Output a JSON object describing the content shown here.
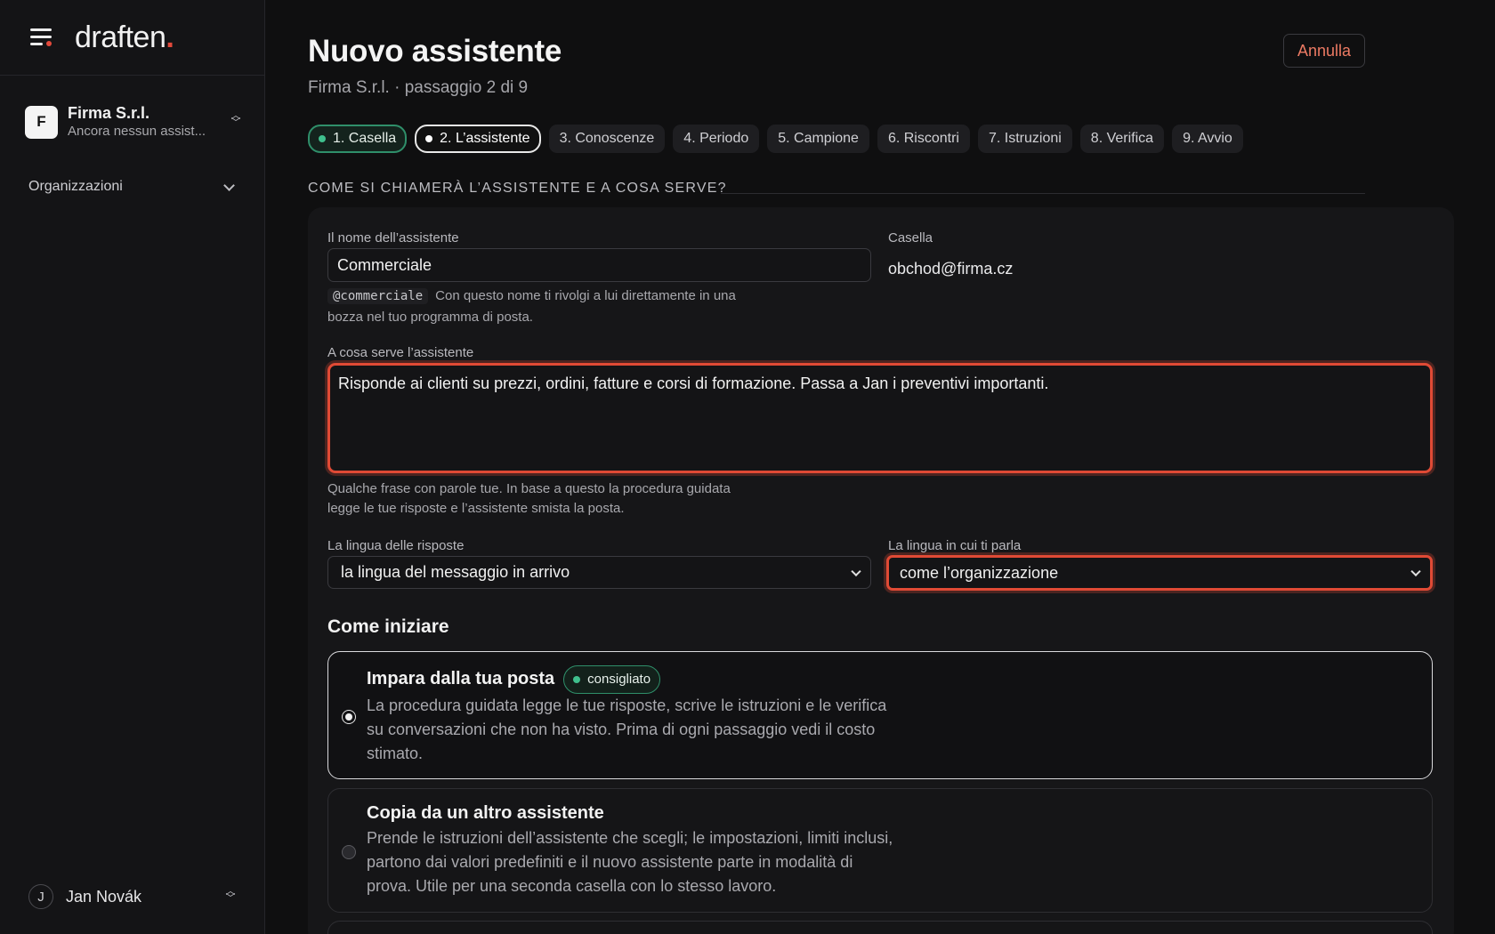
{
  "app": {
    "logo_text": "draften",
    "logo_dot": "."
  },
  "sidebar": {
    "org": {
      "initial": "F",
      "name": "Firma S.r.l.",
      "subtitle": "Ancora nessun assist..."
    },
    "section_label": "Organizzazioni",
    "user": {
      "initial": "J",
      "name": "Jan Novák"
    }
  },
  "header": {
    "title": "Nuovo assistente",
    "subtitle": "Firma S.r.l. · passaggio 2 di 9",
    "cancel_label": "Annulla"
  },
  "steps": [
    {
      "label": "1. Casella",
      "state": "done"
    },
    {
      "label": "2. L’assistente",
      "state": "current"
    },
    {
      "label": "3. Conoscenze",
      "state": "todo"
    },
    {
      "label": "4. Periodo",
      "state": "todo"
    },
    {
      "label": "5. Campione",
      "state": "todo"
    },
    {
      "label": "6. Riscontri",
      "state": "todo"
    },
    {
      "label": "7. Istruzioni",
      "state": "todo"
    },
    {
      "label": "8. Verifica",
      "state": "todo"
    },
    {
      "label": "9. Avvio",
      "state": "todo"
    }
  ],
  "form": {
    "section_title": "Come si chiamerà l’assistente e a cosa serve?",
    "name_label": "Il nome dell’assistente",
    "name_value": "Commerciale",
    "handle": "@commerciale",
    "handle_hint_1": "Con questo nome ti rivolgi a lui direttamente in una",
    "handle_hint_2": "bozza nel tuo programma di posta.",
    "mailbox_label": "Casella",
    "mailbox_value": "obchod@firma.cz",
    "purpose_label": "A cosa serve l’assistente",
    "purpose_value": "Risponde ai clienti su prezzi, ordini, fatture e corsi di formazione. Passa a Jan i preventivi importanti.",
    "purpose_hint_1": "Qualche frase con parole tue. In base a questo la procedura guidata",
    "purpose_hint_2": "legge le tue risposte e l’assistente smista la posta.",
    "reply_lang_label": "La lingua delle risposte",
    "reply_lang_value": "la lingua del messaggio in arrivo",
    "talk_lang_label": "La lingua in cui ti parla",
    "talk_lang_value": "come l’organizzazione"
  },
  "start": {
    "heading": "Come iniziare",
    "options": [
      {
        "title": "Impara dalla tua posta",
        "badge": "consigliato",
        "desc": "La procedura guidata legge le tue risposte, scrive le istruzioni e le verifica su conversazioni che non ha visto. Prima di ogni passaggio vedi il costo stimato.",
        "selected": true
      },
      {
        "title": "Copia da un altro assistente",
        "desc": "Prende le istruzioni dell’assistente che scegli; le impostazioni, limiti inclusi, partono dai valori predefiniti e il nuovo assistente parte in modalità di prova. Utile per una seconda casella con lo stesso lavoro.",
        "selected": false
      }
    ]
  },
  "colors": {
    "accent": "#e2493b",
    "success": "#3fc08d",
    "focus_ring": "#e04a35"
  }
}
